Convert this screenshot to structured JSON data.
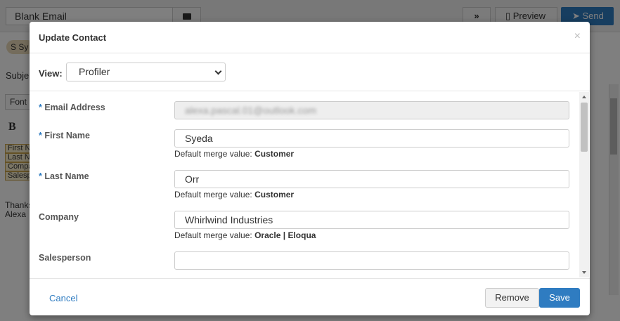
{
  "background": {
    "email_title": "Blank Email",
    "more_label": "»",
    "preview_label": "Preview",
    "send_label": "Send",
    "sender_chip": "S Sy",
    "subject_label": "Subje",
    "font_label": "Font",
    "bold_label": "B",
    "tags": [
      "First N",
      "Last N",
      "Compa",
      "Salesp"
    ],
    "closing_lines": [
      "Thanks",
      "Alexa"
    ]
  },
  "modal": {
    "title": "Update Contact",
    "close_label": "×",
    "view": {
      "label": "View:",
      "selected": "Profiler"
    },
    "fields": [
      {
        "label": "Email Address",
        "required": true,
        "value": "alexa.pascal.01@outlook.com",
        "disabled": true,
        "help_prefix": "",
        "help_value": ""
      },
      {
        "label": "First Name",
        "required": true,
        "value": "Syeda",
        "disabled": false,
        "help_prefix": "Default merge value:",
        "help_value": "Customer"
      },
      {
        "label": "Last Name",
        "required": true,
        "value": "Orr",
        "disabled": false,
        "help_prefix": "Default merge value:",
        "help_value": "Customer"
      },
      {
        "label": "Company",
        "required": false,
        "value": "Whirlwind Industries",
        "disabled": false,
        "help_prefix": "Default merge value:",
        "help_value": "Oracle | Eloqua"
      },
      {
        "label": "Salesperson",
        "required": false,
        "value": "",
        "disabled": false,
        "help_prefix": "",
        "help_value": ""
      }
    ],
    "footer": {
      "cancel_label": "Cancel",
      "remove_label": "Remove",
      "save_label": "Save"
    }
  },
  "colors": {
    "accent": "#2f7cc1",
    "overlay": "#000000"
  }
}
